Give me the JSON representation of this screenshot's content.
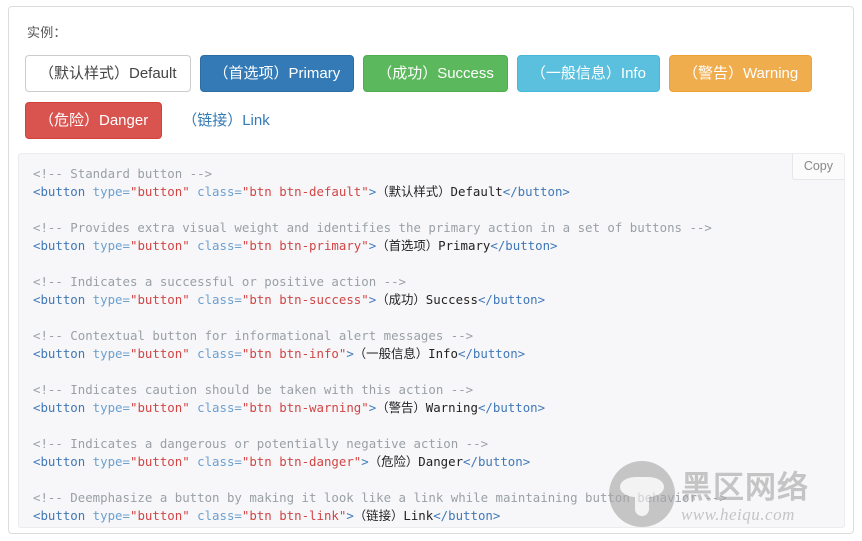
{
  "panel": {
    "example_label": "实例："
  },
  "buttons": [
    {
      "label": "（默认样式）Default",
      "variant": "default"
    },
    {
      "label": "（首选项）Primary",
      "variant": "primary"
    },
    {
      "label": "（成功）Success",
      "variant": "success"
    },
    {
      "label": "（一般信息）Info",
      "variant": "info"
    },
    {
      "label": "（警告）Warning",
      "variant": "warning"
    },
    {
      "label": "（危险）Danger",
      "variant": "danger"
    },
    {
      "label": "（链接）Link",
      "variant": "link"
    }
  ],
  "code_block": {
    "copy_label": "Copy",
    "lines": [
      {
        "comment": "<!-- Standard button -->"
      },
      {
        "tag_open": "<button",
        "attr1": " type=",
        "val1": "\"button\"",
        "attr2": " class=",
        "val2": "\"btn btn-default\"",
        "gt": ">",
        "text": "（默认样式）Default",
        "tag_close": "</button>"
      },
      {
        "blank": true
      },
      {
        "comment": "<!-- Provides extra visual weight and identifies the primary action in a set of buttons -->"
      },
      {
        "tag_open": "<button",
        "attr1": " type=",
        "val1": "\"button\"",
        "attr2": " class=",
        "val2": "\"btn btn-primary\"",
        "gt": ">",
        "text": "（首选项）Primary",
        "tag_close": "</button>"
      },
      {
        "blank": true
      },
      {
        "comment": "<!-- Indicates a successful or positive action -->"
      },
      {
        "tag_open": "<button",
        "attr1": " type=",
        "val1": "\"button\"",
        "attr2": " class=",
        "val2": "\"btn btn-success\"",
        "gt": ">",
        "text": "（成功）Success",
        "tag_close": "</button>"
      },
      {
        "blank": true
      },
      {
        "comment": "<!-- Contextual button for informational alert messages -->"
      },
      {
        "tag_open": "<button",
        "attr1": " type=",
        "val1": "\"button\"",
        "attr2": " class=",
        "val2": "\"btn btn-info\"",
        "gt": ">",
        "text": "（一般信息）Info",
        "tag_close": "</button>"
      },
      {
        "blank": true
      },
      {
        "comment": "<!-- Indicates caution should be taken with this action -->"
      },
      {
        "tag_open": "<button",
        "attr1": " type=",
        "val1": "\"button\"",
        "attr2": " class=",
        "val2": "\"btn btn-warning\"",
        "gt": ">",
        "text": "（警告）Warning",
        "tag_close": "</button>"
      },
      {
        "blank": true
      },
      {
        "comment": "<!-- Indicates a dangerous or potentially negative action -->"
      },
      {
        "tag_open": "<button",
        "attr1": " type=",
        "val1": "\"button\"",
        "attr2": " class=",
        "val2": "\"btn btn-danger\"",
        "gt": ">",
        "text": "（危险）Danger",
        "tag_close": "</button>"
      },
      {
        "blank": true
      },
      {
        "comment": "<!-- Deemphasize a button by making it look like a link while maintaining button behavior -->"
      },
      {
        "tag_open": "<button",
        "attr1": " type=",
        "val1": "\"button\"",
        "attr2": " class=",
        "val2": "\"btn btn-link\"",
        "gt": ">",
        "text": "（链接）Link",
        "tag_close": "</button>"
      }
    ]
  },
  "watermark": {
    "site_name": "黑区网络",
    "url": "www.heiqu.com"
  },
  "colors": {
    "primary": "#337ab7",
    "success": "#5cb85c",
    "info": "#5bc0de",
    "warning": "#f0ad4e",
    "danger": "#d9534f",
    "code_bg": "#f7f7f9",
    "comment": "#9aa0a6",
    "attr_value": "#d14545",
    "tag": "#4078b8"
  }
}
